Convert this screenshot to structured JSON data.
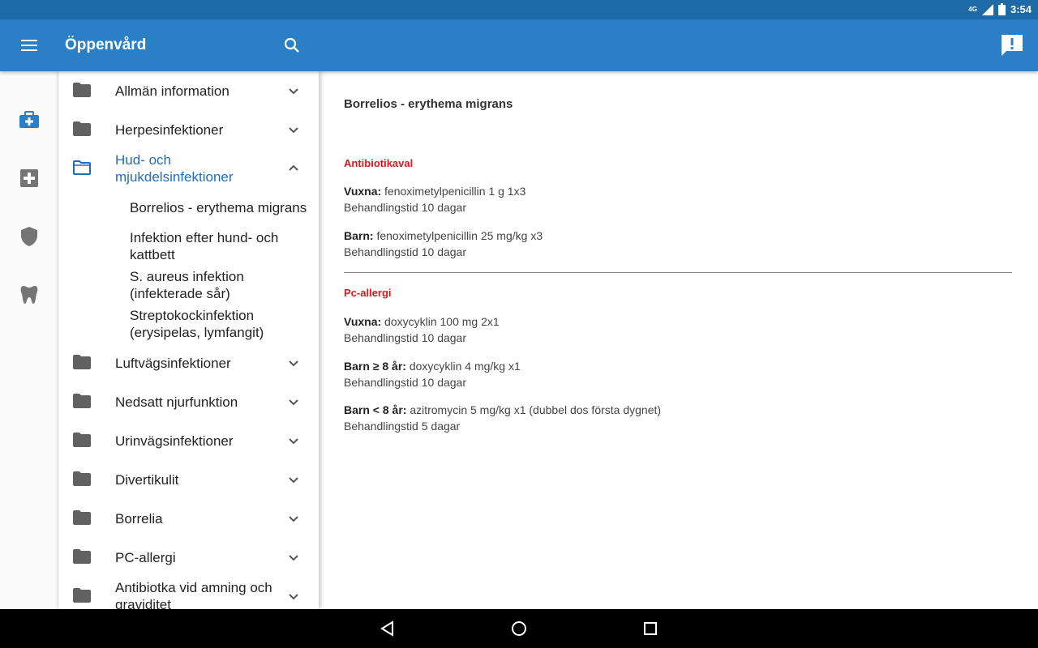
{
  "status": {
    "network": "4G",
    "time": "3:54"
  },
  "appbar": {
    "title": "Öppenvård",
    "icons": [
      "menu-icon",
      "search-icon",
      "feedback-icon"
    ]
  },
  "rail": {
    "items": [
      "medical-kit-icon",
      "first-aid-icon",
      "shield-icon",
      "tooth-icon"
    ]
  },
  "drawer": {
    "categories": [
      {
        "label": "Allmän information",
        "expanded": false
      },
      {
        "label": "Herpesinfektioner",
        "expanded": false
      },
      {
        "label": "Hud- och mjukdelsinfektioner",
        "expanded": true
      },
      {
        "label": "Luftvägsinfektioner",
        "expanded": false
      },
      {
        "label": "Nedsatt njurfunktion",
        "expanded": false
      },
      {
        "label": "Urinvägsinfektioner",
        "expanded": false
      },
      {
        "label": "Divertikulit",
        "expanded": false
      },
      {
        "label": "Borrelia",
        "expanded": false
      },
      {
        "label": "PC-allergi",
        "expanded": false
      },
      {
        "label": "Antibiotka vid amning och graviditet",
        "expanded": false
      }
    ],
    "subitems": [
      "Borrelios - erythema migrans",
      "Infektion efter hund- och kattbett",
      "S. aureus infektion (infekterade sår)",
      "Streptokockinfektion (erysipelas, lymfangit)"
    ]
  },
  "content": {
    "title": "Borrelios - erythema migrans",
    "sections": [
      {
        "heading": "Antibiotikaval",
        "entries": [
          {
            "label": "Vuxna:",
            "text": " fenoximetylpenicillin 1 g 1x3",
            "duration": "Behandlingstid 10 dagar"
          },
          {
            "label": "Barn:",
            "text": " fenoximetylpenicillin 25 mg/kg x3",
            "duration": "Behandlingstid 10 dagar"
          }
        ]
      },
      {
        "heading": "Pc-allergi",
        "entries": [
          {
            "label": "Vuxna:",
            "text": " doxycyklin 100 mg 2x1",
            "duration": "Behandlingstid 10 dagar"
          },
          {
            "label": "Barn ≥ 8 år:",
            "text": " doxycyklin 4 mg/kg x1",
            "duration": "Behandlingstid 10 dagar"
          },
          {
            "label": "Barn < 8 år:",
            "text": " azitromycin 5 mg/kg x1 (dubbel dos första dygnet)",
            "duration": "Behandlingstid 5 dagar"
          }
        ]
      }
    ]
  },
  "navbar": {
    "icons": [
      "back-icon",
      "home-icon",
      "recents-icon"
    ]
  },
  "colors": {
    "appbar": "#2b80c5",
    "statusbar": "#1e6aa6",
    "accent": "#1f6cc2",
    "heading_red": "#e0161b"
  }
}
